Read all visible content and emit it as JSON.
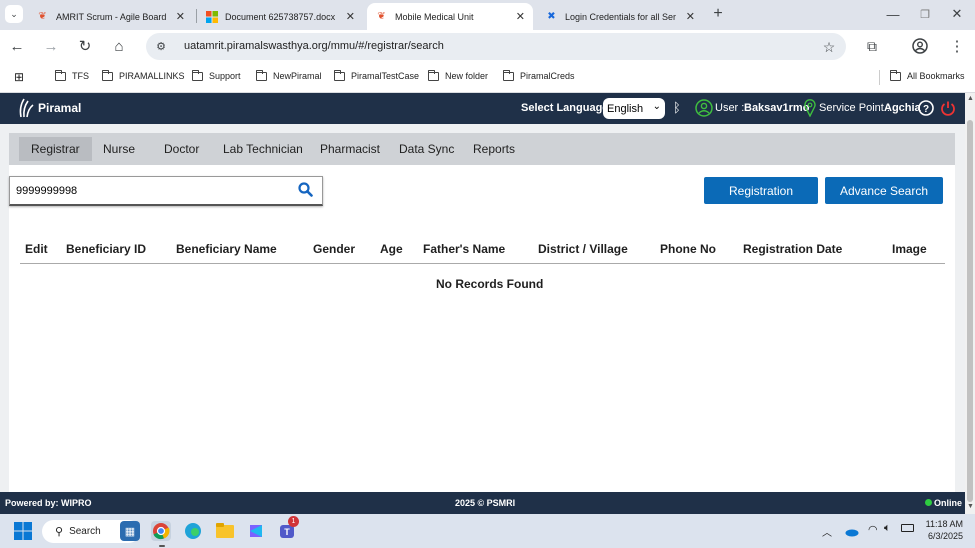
{
  "browser": {
    "tabs": [
      {
        "title": "AMRIT Scrum - Agile Board",
        "active": false
      },
      {
        "title": "Document 625738757.docx",
        "active": false
      },
      {
        "title": "Mobile Medical Unit",
        "active": true
      },
      {
        "title": "Login Credentials for all Ser",
        "active": false
      }
    ],
    "url": "uatamrit.piramalswasthya.org/mmu/#/registrar/search",
    "bookmarks": [
      "TFS",
      "PIRAMALLINKS",
      "Support",
      "NewPiramal",
      "PiramalTestCase",
      "New folder",
      "PiramalCreds"
    ],
    "all_bookmarks": "All Bookmarks"
  },
  "header": {
    "brand": "Piramal",
    "select_language_label": "Select Language:",
    "language": "English",
    "user_label": "User :",
    "user_name": "Baksav1rmo",
    "service_point_label": "Service Point :",
    "service_point": "Agchia"
  },
  "menu": [
    "Registrar",
    "Nurse",
    "Doctor",
    "Lab Technician",
    "Pharmacist",
    "Data Sync",
    "Reports"
  ],
  "search": {
    "value": "9999999998"
  },
  "buttons": {
    "registration": "Registration",
    "advance_search": "Advance Search"
  },
  "table": {
    "columns": [
      "Edit",
      "Beneficiary ID",
      "Beneficiary Name",
      "Gender",
      "Age",
      "Father's Name",
      "District / Village",
      "Phone No",
      "Registration Date",
      "Image"
    ],
    "empty_text": "No Records Found"
  },
  "footer": {
    "left": "Powered by: WIPRO",
    "center": "2025 © PSMRI",
    "status": "Online"
  },
  "taskbar": {
    "search": "Search",
    "time": "11:18 AM",
    "date": "6/3/2025",
    "teams_badge": "1"
  },
  "colors": {
    "header": "#1f3048",
    "primary_button": "#0b6ab7",
    "online": "#2ecc40"
  }
}
